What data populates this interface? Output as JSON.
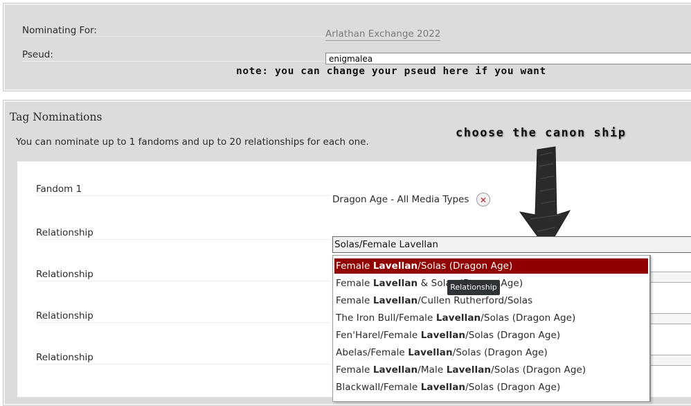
{
  "nomination": {
    "nominating_label": "Nominating For:",
    "exchange_link": "Arlathan Exchange 2022",
    "pseud_label": "Pseud:",
    "pseud_value": "enigmalea",
    "note": "note: you can change your pseud here if you want"
  },
  "tags": {
    "heading": "Tag Nominations",
    "description": "You can nominate up to 1 fandoms and up to 20 relationships for each one.",
    "fandom_label": "Fandom 1",
    "fandom_tag": "Dragon Age - All Media Types",
    "fandom_remove_icon": "close-icon",
    "relationship_label": "Relationship",
    "relationship_input": "Solas/Female Lavellan",
    "annotation": "choose the canon ship",
    "tooltip": "Relationship",
    "suggestions": [
      {
        "pre": "Female ",
        "bold": "Lavellan",
        "post": "/Solas (Dragon Age)"
      },
      {
        "pre": "Female ",
        "bold": "Lavellan",
        "post": " & Solas (Dragon Age)"
      },
      {
        "pre": "Female ",
        "bold": "Lavellan",
        "post": "/Cullen Rutherford/Solas"
      },
      {
        "pre": "The Iron Bull/Female ",
        "bold": "Lavellan",
        "post": "/Solas (Dragon Age)"
      },
      {
        "pre": "Fen'Harel/Female ",
        "bold": "Lavellan",
        "post": "/Solas (Dragon Age)"
      },
      {
        "pre": "Abelas/Female ",
        "bold": "Lavellan",
        "post": "/Solas (Dragon Age)"
      },
      {
        "pre": "Female ",
        "bold": "Lavellan",
        "post": "/Male ",
        "bold2": "Lavellan",
        "post2": "/Solas (Dragon Age)"
      },
      {
        "pre": "Blackwall/Female ",
        "bold": "Lavellan",
        "post": "/Solas (Dragon Age)"
      }
    ],
    "accent_color": "#900000"
  }
}
